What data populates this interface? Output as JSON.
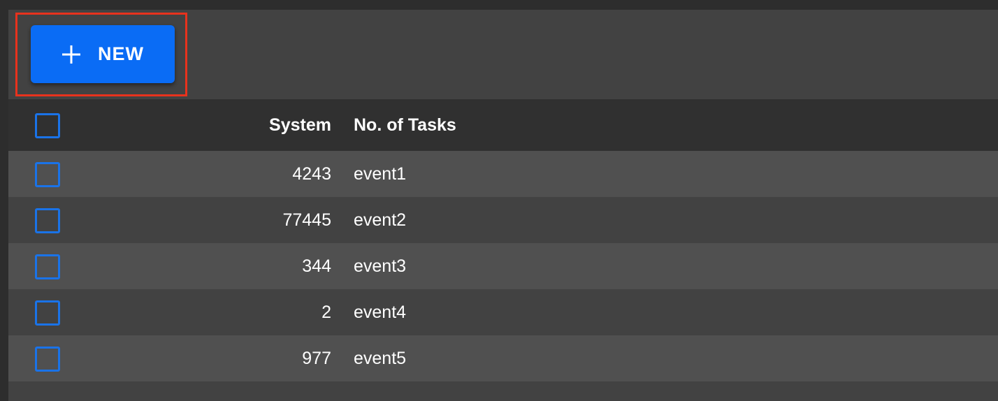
{
  "toolbar": {
    "new_button_label": "NEW",
    "new_button_icon": "plus-icon",
    "accent_color": "#0a6cf5",
    "highlight_color": "#e8321d"
  },
  "table": {
    "headers": {
      "system": "System",
      "tasks": "No. of Tasks"
    },
    "rows": [
      {
        "system": "4243",
        "tasks": "event1"
      },
      {
        "system": "77445",
        "tasks": "event2"
      },
      {
        "system": "344",
        "tasks": "event3"
      },
      {
        "system": "2",
        "tasks": "event4"
      },
      {
        "system": "977",
        "tasks": "event5"
      }
    ]
  }
}
